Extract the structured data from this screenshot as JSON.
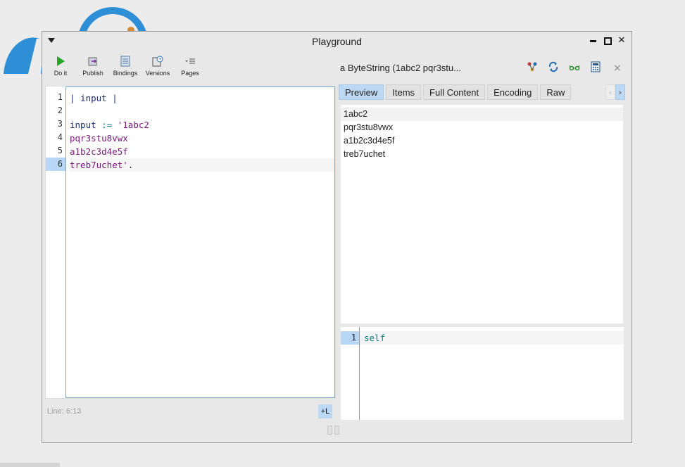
{
  "window": {
    "title": "Playground"
  },
  "toolbar": {
    "items": [
      {
        "label": "Do it",
        "icon": "play-icon"
      },
      {
        "label": "Publish",
        "icon": "publish-icon"
      },
      {
        "label": "Bindings",
        "icon": "bindings-icon"
      },
      {
        "label": "Versions",
        "icon": "versions-icon"
      },
      {
        "label": "Pages",
        "icon": "pages-icon"
      }
    ]
  },
  "editor": {
    "line_numbers": [
      "1",
      "2",
      "3",
      "4",
      "5",
      "6"
    ],
    "current_line": 6,
    "status": "Line: 6:13",
    "line_toggle_label": "+L"
  },
  "inspector": {
    "title": "a ByteString (1abc2 pqr3stu...",
    "tabs": [
      "Preview",
      "Items",
      "Full Content",
      "Encoding",
      "Raw"
    ],
    "active_tab": "Preview",
    "preview_lines": [
      "1abc2",
      "pqr3stu8vwx",
      "a1b2c3d4e5f",
      "treb7uchet"
    ],
    "eval_line_number": "1",
    "eval_code": "self",
    "icons": [
      "browse-icon",
      "refresh-icon",
      "glasses-icon",
      "calculator-icon",
      "close-icon"
    ],
    "close_label": "×"
  },
  "code_lines": {
    "l1_a": "| ",
    "l1_b": "input",
    "l1_c": " |",
    "l3_a": "input",
    "l3_b": " := ",
    "l3_c": "'1abc2",
    "l4": "pqr3stu8vwx",
    "l5": "a1b2c3d4e5f",
    "l6_a": "treb7uchet'",
    "l6_b": "."
  },
  "colors": {
    "accent": "#bcd8f3",
    "variable": "#1b2f7a",
    "operator": "#0a7a7a",
    "string": "#7a1a7a"
  }
}
